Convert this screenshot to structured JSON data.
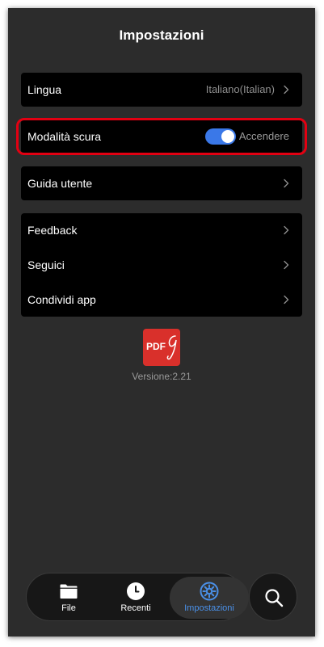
{
  "header": {
    "title": "Impostazioni"
  },
  "settings": {
    "language": {
      "label": "Lingua",
      "value": "Italiano(Italian)"
    },
    "dark_mode": {
      "label": "Modalità scura",
      "toggle_label": "Accendere",
      "enabled": true
    },
    "guide": {
      "label": "Guida utente"
    },
    "feedback": {
      "label": "Feedback"
    },
    "follow": {
      "label": "Seguici"
    },
    "share": {
      "label": "Condividi app"
    }
  },
  "app": {
    "logo_text": "PDF",
    "version": "Versione:2.21"
  },
  "tabbar": {
    "tabs": [
      {
        "label": "File",
        "icon": "folder-icon",
        "active": false
      },
      {
        "label": "Recenti",
        "icon": "clock-icon",
        "active": false
      },
      {
        "label": "Impostazioni",
        "icon": "gear-icon",
        "active": true
      }
    ],
    "search_icon": "search-icon"
  },
  "colors": {
    "background": "#2c2c2c",
    "card": "#000000",
    "accent": "#3a78e8",
    "active_tab_label": "#4a90e8",
    "highlight": "#e20012",
    "logo": "#d9302b"
  }
}
